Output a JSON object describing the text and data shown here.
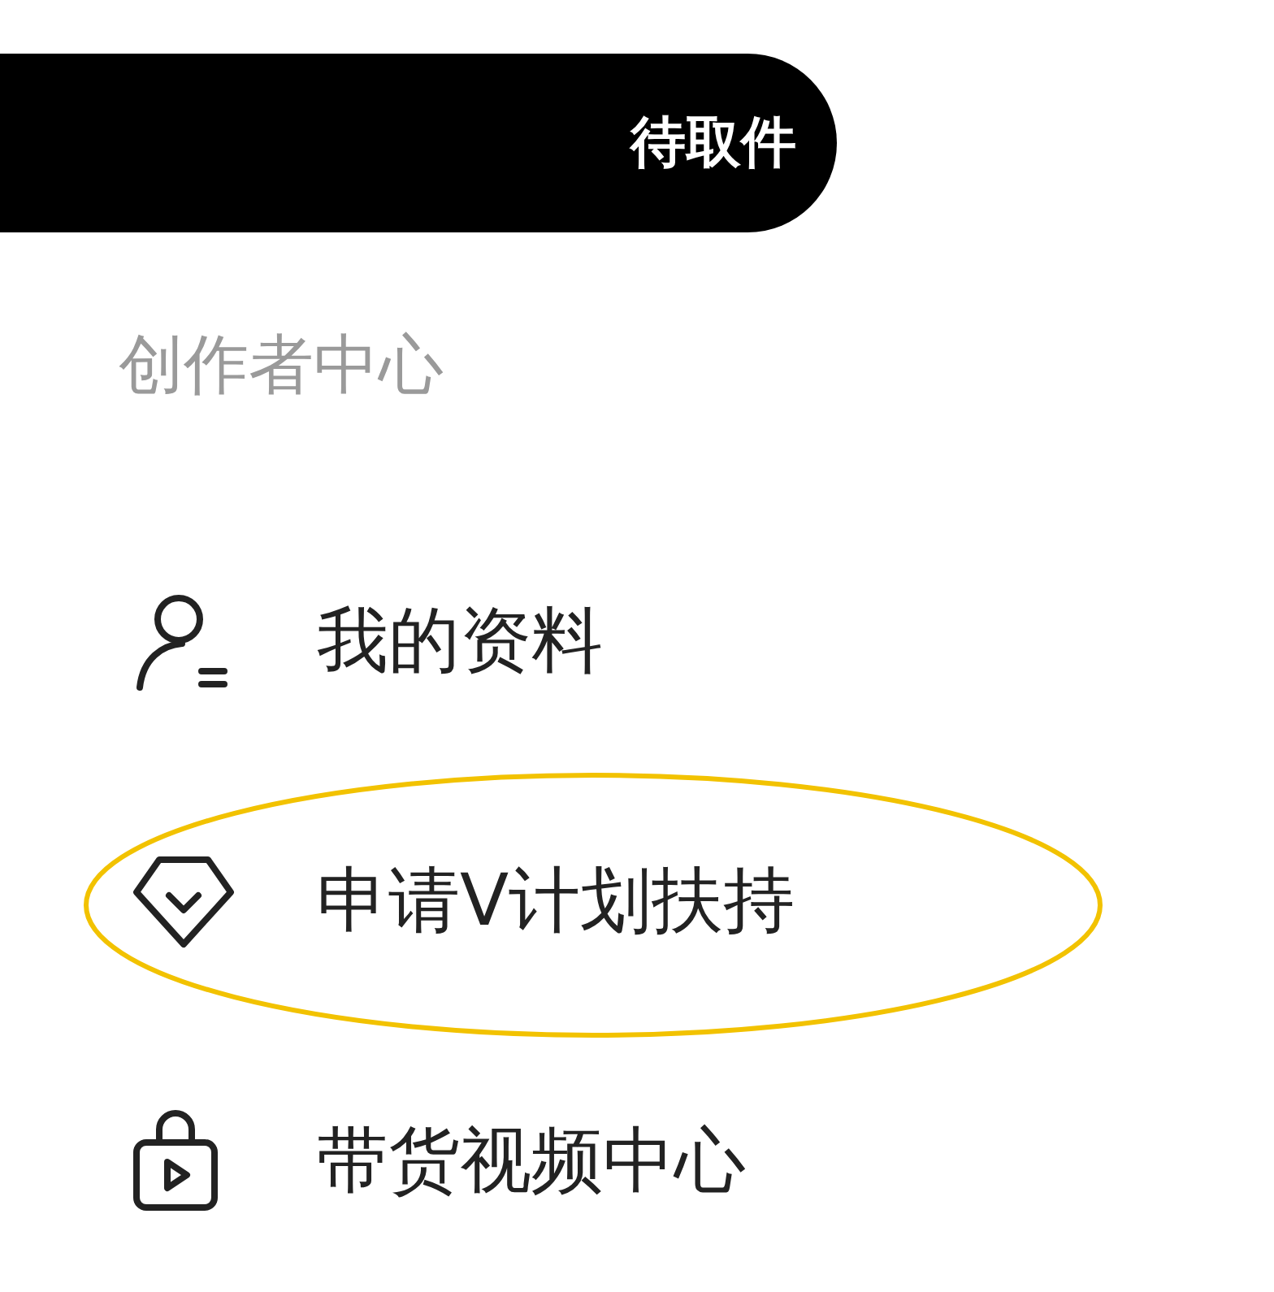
{
  "top_button": {
    "label": "待取件"
  },
  "section_title": "创作者中心",
  "menu_items": [
    {
      "kind": "profile",
      "label": "我的资料",
      "circled": false
    },
    {
      "kind": "badge",
      "label": "申请V计划扶持",
      "circled": true
    },
    {
      "kind": "bag",
      "label": "带货视频中心",
      "circled": false
    }
  ]
}
